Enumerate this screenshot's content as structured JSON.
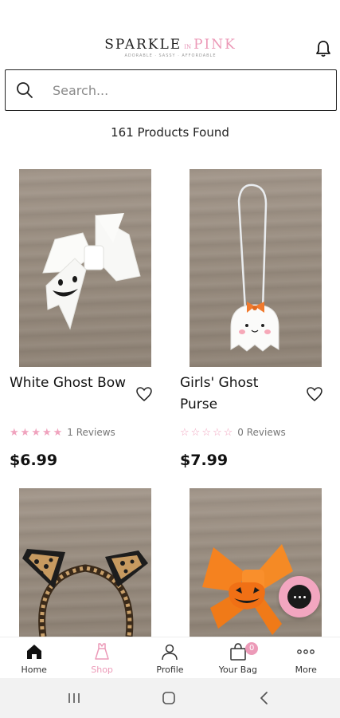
{
  "header": {
    "logo_main": "SPARKLE",
    "logo_in": "IN",
    "logo_pink": "PINK",
    "logo_tagline": "ADORABLE · SASSY · AFFORDABLE"
  },
  "search": {
    "placeholder": "Search..."
  },
  "results": {
    "count_text": "161 Products Found"
  },
  "products": [
    {
      "title": "White Ghost Bow",
      "rating": 5,
      "reviews": "1 Reviews",
      "price": "$6.99"
    },
    {
      "title": "Girls' Ghost Purse",
      "rating": 0,
      "reviews": "0 Reviews",
      "price": "$7.99"
    },
    {
      "title": "",
      "rating": null,
      "reviews": "",
      "price": ""
    },
    {
      "title": "",
      "rating": null,
      "reviews": "",
      "price": ""
    }
  ],
  "tabbar": {
    "items": [
      {
        "label": "Home",
        "icon": "home-icon",
        "active": false
      },
      {
        "label": "Shop",
        "icon": "dress-icon",
        "active": true
      },
      {
        "label": "Profile",
        "icon": "person-icon",
        "active": false
      },
      {
        "label": "Your Bag",
        "icon": "bag-icon",
        "active": false,
        "badge": "0"
      },
      {
        "label": "More",
        "icon": "more-dots-icon",
        "active": false
      }
    ]
  },
  "colors": {
    "accent_pink": "#ec9ab8",
    "fab_bg": "#f2a6c0",
    "text": "#111111"
  }
}
